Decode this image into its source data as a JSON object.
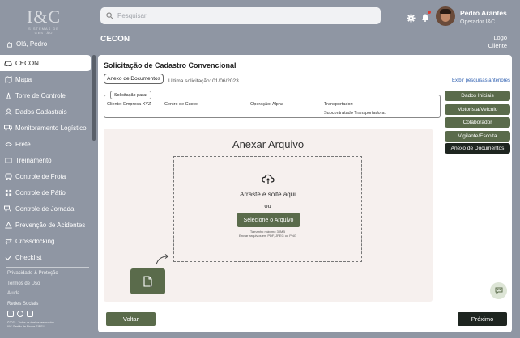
{
  "brand": {
    "logo_text": "I&C",
    "logo_subtext": "SISTEMAS DE GESTÃO"
  },
  "sidebar": {
    "greeting": "Olá, Pedro",
    "items": [
      {
        "label": "CECON",
        "icon": "car-icon",
        "active": true
      },
      {
        "label": "Mapa",
        "icon": "map-icon"
      },
      {
        "label": "Torre de Controle",
        "icon": "tower-icon"
      },
      {
        "label": "Dados Cadastrais",
        "icon": "user-data-icon"
      },
      {
        "label": "Monitoramento Logístico",
        "icon": "truck-icon"
      },
      {
        "label": "Frete",
        "icon": "freight-icon"
      },
      {
        "label": "Treinamento",
        "icon": "training-icon"
      },
      {
        "label": "Controle de Frota",
        "icon": "fleet-icon"
      },
      {
        "label": "Controle de Pátio",
        "icon": "yard-icon"
      },
      {
        "label": "Controle de Jornada",
        "icon": "journey-icon"
      },
      {
        "label": "Prevenção de Acidentes",
        "icon": "accident-icon"
      },
      {
        "label": "Crossdocking",
        "icon": "crossdocking-icon"
      },
      {
        "label": "Checklist",
        "icon": "checklist-icon"
      }
    ],
    "footer_links": [
      "Privacidade & Proteção",
      "Termos de Uso",
      "Ajuda",
      "Redes Sociais"
    ],
    "copyright_line1": "©2023 - Todos os direitos reservados",
    "copyright_line2": "I&C Gestão de Riscos EIRELI"
  },
  "header": {
    "search_placeholder": "Pesquisar",
    "user_name": "Pedro Arantes",
    "user_role": "Operador I&C",
    "page_title": "CECON",
    "company_label": "Logo Cliente"
  },
  "main": {
    "title": "Solicitação de Cadastro Convencional",
    "tab_label": "Anexo de Documentos",
    "last_request": "Última solicitação: 01/06/2023",
    "show_previous": "Exibir pesquisas anteriores",
    "request_for": {
      "legend": "Solicitação para:",
      "cliente": "Cliente: Empresa XYZ",
      "centro_custo": "Centro de Custo:",
      "operacao": "Operação: Alpha",
      "transportador": "Transportador:",
      "subcontratado": "Subcontratado Transportadora:"
    },
    "steps": [
      "Dados Iniciais",
      "Motorista/Veículo",
      "Colaborador",
      "Vigilante/Escolta",
      "Anexo de Documentos"
    ],
    "active_step": 4,
    "upload": {
      "title": "Anexar Arquivo",
      "drag_text": "Arraste e solte aqui",
      "or_text": "ou",
      "select_button": "Selecione o Arquivo",
      "max_size": "Tamanho máximo 30MB",
      "formats": "Enviar arquivos em PDF, JPEG ou PNG"
    },
    "back_button": "Voltar",
    "next_button": "Próximo"
  },
  "colors": {
    "accent": "#5a6b4b",
    "dark": "#1e2520",
    "bg": "#8f96a3",
    "link": "#2e5fb0"
  }
}
